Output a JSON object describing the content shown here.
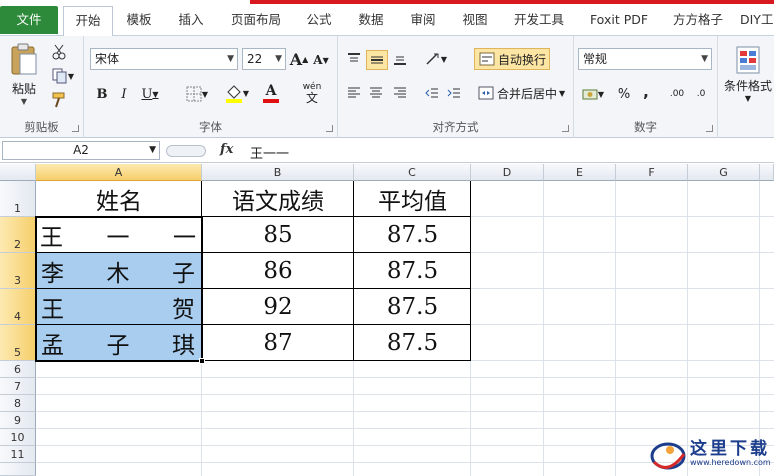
{
  "tabs": [
    {
      "label": "文件",
      "type": "file"
    },
    {
      "label": "开始",
      "type": "active"
    },
    {
      "label": "模板"
    },
    {
      "label": "插入"
    },
    {
      "label": "页面布局"
    },
    {
      "label": "公式"
    },
    {
      "label": "数据"
    },
    {
      "label": "审阅"
    },
    {
      "label": "视图"
    },
    {
      "label": "开发工具"
    },
    {
      "label": "Foxit PDF"
    },
    {
      "label": "方方格子"
    },
    {
      "label": "DIY工"
    }
  ],
  "ribbon": {
    "clipboard": {
      "label": "剪贴板",
      "paste": "粘贴"
    },
    "font": {
      "label": "字体",
      "family": "宋体",
      "size": "22",
      "bold": "B",
      "italic": "I",
      "underline": "U",
      "wen": "wén",
      "wen_char": "文",
      "grow": "A",
      "shrink": "A"
    },
    "alignment": {
      "label": "对齐方式",
      "wrap": "自动换行",
      "merge": "合并后居中"
    },
    "number": {
      "label": "数字",
      "format": "常规",
      "percent": "%",
      "comma": ",",
      "dec_inc": ".00",
      "dec_dec": ".0"
    },
    "styles": {
      "cond": "条件格式"
    }
  },
  "formula_bar": {
    "name_box": "A2",
    "fx": "fx",
    "value": "王一一"
  },
  "columns": [
    "A",
    "B",
    "C",
    "D",
    "E",
    "F",
    "G"
  ],
  "rows": [
    "1",
    "2",
    "3",
    "4",
    "5",
    "6",
    "7",
    "8",
    "9",
    "10",
    "11"
  ],
  "table": {
    "headers": [
      "姓名",
      "语文成绩",
      "平均值"
    ],
    "rows": [
      {
        "name": [
          "王",
          "一",
          "一"
        ],
        "score": "85",
        "avg": "87.5"
      },
      {
        "name": [
          "李",
          "木",
          "子"
        ],
        "score": "86",
        "avg": "87.5"
      },
      {
        "name": [
          "王",
          "贺"
        ],
        "score": "92",
        "avg": "87.5"
      },
      {
        "name": [
          "孟",
          "子",
          "琪"
        ],
        "score": "87",
        "avg": "87.5"
      }
    ]
  },
  "watermark": {
    "text": "这里下载",
    "url": "www.heredown.com"
  },
  "colors": {
    "file_tab": "#2d8a3a",
    "selection": "#a8cdef",
    "header_highlight": "#f6cf6b"
  }
}
